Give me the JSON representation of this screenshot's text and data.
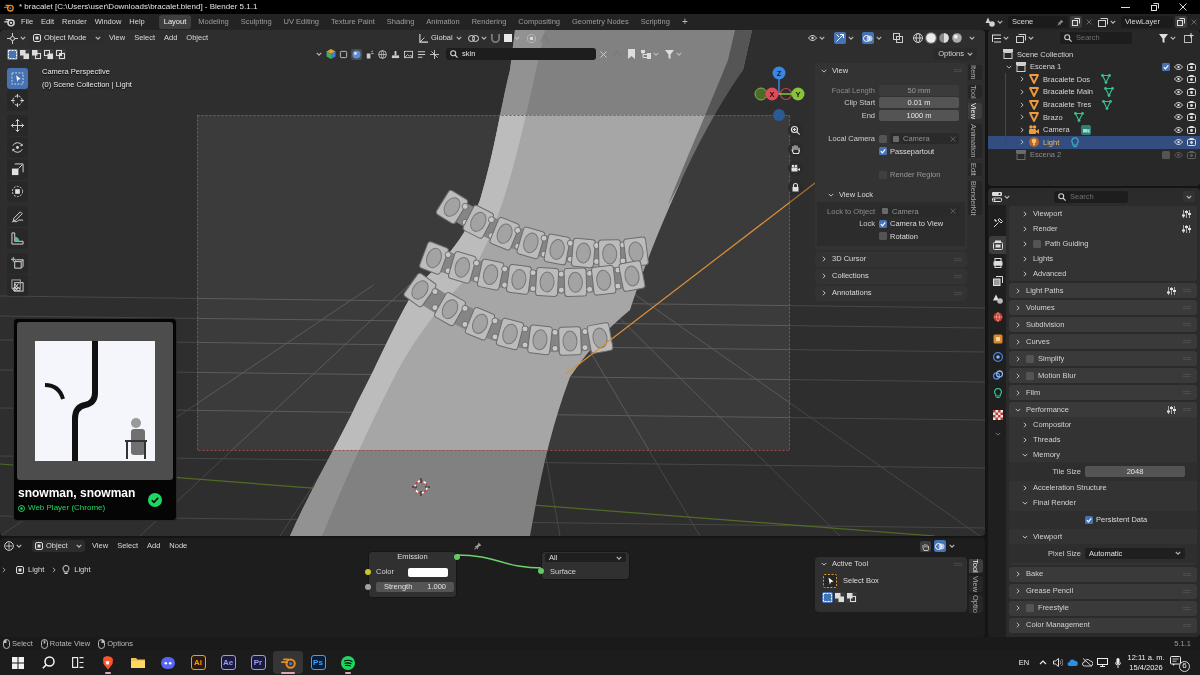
{
  "title_bar": {
    "title": "* bracalet [C:\\Users\\user\\Downloads\\bracalet.blend] - Blender 5.1.1"
  },
  "top_bar": {
    "menus": [
      "File",
      "Edit",
      "Render",
      "Window",
      "Help"
    ],
    "workspaces": [
      {
        "label": "Layout",
        "selected": true
      },
      {
        "label": "Modeling",
        "selected": false
      },
      {
        "label": "Sculpting",
        "selected": false
      },
      {
        "label": "UV Editing",
        "selected": false
      },
      {
        "label": "Texture Paint",
        "selected": false
      },
      {
        "label": "Shading",
        "selected": false
      },
      {
        "label": "Animation",
        "selected": false
      },
      {
        "label": "Rendering",
        "selected": false
      },
      {
        "label": "Compositing",
        "selected": false
      },
      {
        "label": "Geometry Nodes",
        "selected": false
      },
      {
        "label": "Scripting",
        "selected": false
      }
    ],
    "add_workspace": "+",
    "scene": "Scene",
    "view_layer": "ViewLayer"
  },
  "viewport": {
    "header": {
      "mode": "Object Mode",
      "menus": [
        "View",
        "Select",
        "Add",
        "Object"
      ],
      "orientation": "Global",
      "shading_modes": [
        {
          "kind": "wireframe",
          "selected": false
        },
        {
          "kind": "solid",
          "selected": true
        },
        {
          "kind": "material",
          "selected": false
        },
        {
          "kind": "rendered",
          "selected": false
        }
      ],
      "select_modes": [
        {
          "kind": "set",
          "selected": true
        },
        {
          "kind": "extend",
          "selected": false
        },
        {
          "kind": "subtract",
          "selected": false
        },
        {
          "kind": "invert",
          "selected": false
        },
        {
          "kind": "intersect",
          "selected": false
        }
      ],
      "search": "skin",
      "options": "Options"
    },
    "info": [
      "Camera Perspective",
      "(0) Scene Collection | Light"
    ],
    "tool_groups": [
      [
        {
          "kind": "select",
          "selected": true
        },
        {
          "kind": "cursor",
          "selected": false
        }
      ],
      [
        {
          "kind": "move",
          "selected": false
        },
        {
          "kind": "rotate",
          "selected": false
        },
        {
          "kind": "scale",
          "selected": false
        },
        {
          "kind": "transform",
          "selected": false
        }
      ],
      [
        {
          "kind": "annotate",
          "selected": false
        },
        {
          "kind": "measure",
          "selected": false
        }
      ],
      [
        {
          "kind": "add-cube",
          "selected": false
        },
        {
          "kind": "cut",
          "selected": false
        }
      ]
    ],
    "gizmo": {
      "x": "X",
      "y": "Y",
      "z": "Z"
    },
    "sidebar": {
      "tabs": [
        {
          "label": "Item",
          "selected": false
        },
        {
          "label": "Tool",
          "selected": false
        },
        {
          "label": "View",
          "selected": true
        },
        {
          "label": "Animation",
          "selected": false
        },
        {
          "label": "Edit",
          "selected": false
        },
        {
          "label": "BlenderKit",
          "selected": false
        }
      ],
      "panels": [
        {
          "title": "View",
          "expanded": true,
          "groups": [
            [
              {
                "kind": "number",
                "label": "Focal Length",
                "value": "50 mm",
                "disabled": true
              },
              {
                "kind": "number",
                "label": "Clip Start",
                "value": "0.01 m",
                "disabled": false
              },
              {
                "kind": "number",
                "label": "End",
                "value": "1000 m",
                "disabled": false
              }
            ],
            [
              {
                "kind": "object",
                "label": "Local Camera",
                "checked": false,
                "value": "Camera",
                "disabled": true
              },
              {
                "kind": "check",
                "text": "Passepartout",
                "checked": true,
                "disabled": false
              }
            ],
            [
              {
                "kind": "check",
                "text": "Render Region",
                "checked": false,
                "disabled": true
              }
            ]
          ],
          "subpanels": [
            {
              "title": "View Lock",
              "expanded": true,
              "rows": [
                {
                  "kind": "object",
                  "label": "Lock to Object",
                  "value": "Camera",
                  "disabled": true
                },
                {
                  "kind": "check",
                  "label": "Lock",
                  "text": "Camera to View",
                  "checked": true,
                  "disabled": false
                },
                {
                  "kind": "check",
                  "text": "Rotation",
                  "checked": false,
                  "disabled": false
                }
              ]
            }
          ]
        },
        {
          "title": "3D Cursor",
          "expanded": false
        },
        {
          "title": "Collections",
          "expanded": false
        },
        {
          "title": "Annotations",
          "expanded": false
        }
      ]
    },
    "media_player": {
      "title": "snowman, snowman",
      "device": "Web Player (Chrome)"
    }
  },
  "outliner": {
    "search_placeholder": "Search",
    "tree": [
      {
        "kind": "scene-collection",
        "label": "Scene Collection",
        "selected": false,
        "children": [
          {
            "kind": "collection",
            "label": "Escena 1",
            "expanded": true,
            "included": true,
            "selected": false,
            "children": [
              {
                "kind": "mesh",
                "label": "Bracalete Dos",
                "expanded": false,
                "selected": false
              },
              {
                "kind": "mesh",
                "label": "Bracalete Main",
                "expanded": false,
                "selected": false
              },
              {
                "kind": "mesh",
                "label": "Bracalete Tres",
                "expanded": false,
                "selected": false
              },
              {
                "kind": "mesh",
                "label": "Brazo",
                "expanded": false,
                "selected": false
              },
              {
                "kind": "camera",
                "label": "Camera",
                "expanded": false,
                "selected": false
              },
              {
                "kind": "light",
                "label": "Light",
                "expanded": false,
                "selected": true
              }
            ]
          },
          {
            "kind": "collection",
            "label": "Escena 2",
            "included": false,
            "selected": false
          }
        ]
      }
    ]
  },
  "properties": {
    "search_placeholder": "Search",
    "tab_groups": [
      [
        {
          "kind": "tool",
          "selected": false
        }
      ],
      [
        {
          "kind": "render",
          "selected": true
        },
        {
          "kind": "output",
          "selected": false
        },
        {
          "kind": "view-layer",
          "selected": false
        },
        {
          "kind": "scene",
          "selected": false
        },
        {
          "kind": "world",
          "selected": false
        }
      ],
      [
        {
          "kind": "object",
          "selected": false
        },
        {
          "kind": "physics",
          "selected": false
        },
        {
          "kind": "constraints",
          "selected": false
        },
        {
          "kind": "light-data",
          "selected": false
        }
      ],
      [
        {
          "kind": "texture",
          "selected": false
        }
      ]
    ],
    "top_subpanels": [
      {
        "title": "Viewport",
        "expanded": false,
        "presets": true
      },
      {
        "title": "Render",
        "expanded": false,
        "presets": true
      },
      {
        "title": "Path Guiding",
        "expanded": false,
        "checked": false
      },
      {
        "title": "Lights",
        "expanded": false
      },
      {
        "title": "Advanced",
        "expanded": false
      }
    ],
    "panels": [
      {
        "title": "Light Paths",
        "expanded": false,
        "presets": true
      },
      {
        "title": "Volumes",
        "expanded": false
      },
      {
        "title": "Subdivision",
        "expanded": false
      },
      {
        "title": "Curves",
        "expanded": false
      },
      {
        "title": "Simplify",
        "expanded": false,
        "checked": false
      },
      {
        "title": "Motion Blur",
        "expanded": false,
        "checked": false
      },
      {
        "title": "Film",
        "expanded": false
      },
      {
        "title": "Performance",
        "expanded": true,
        "presets": true,
        "children": [
          {
            "kind": "subpanel",
            "title": "Compositor",
            "expanded": false
          },
          {
            "kind": "subpanel",
            "title": "Threads",
            "expanded": false
          },
          {
            "kind": "subpanel",
            "title": "Memory",
            "expanded": true,
            "children": [
              {
                "kind": "number",
                "label": "Tile Size",
                "value": "2048"
              }
            ]
          },
          {
            "kind": "subpanel",
            "title": "Acceleration Structure",
            "expanded": false
          },
          {
            "kind": "subpanel",
            "title": "Final Render",
            "expanded": true,
            "children": [
              {
                "kind": "check",
                "text": "Persistent Data",
                "checked": true
              }
            ]
          },
          {
            "kind": "subpanel",
            "title": "Viewport",
            "expanded": true,
            "children": [
              {
                "kind": "dropdown",
                "label": "Pixel Size",
                "value": "Automatic"
              }
            ]
          }
        ]
      },
      {
        "title": "Bake",
        "expanded": false
      },
      {
        "title": "Grease Pencil",
        "expanded": false
      },
      {
        "title": "Freestyle",
        "expanded": false,
        "checked": false
      },
      {
        "title": "Color Management",
        "expanded": false
      }
    ]
  },
  "node_editor": {
    "header": {
      "data_type": "Object",
      "menus": [
        "View",
        "Select",
        "Add",
        "Node"
      ]
    },
    "breadcrumbs": [
      "Light",
      "Light"
    ],
    "emission_node": {
      "title": "Emission",
      "color_label": "Color",
      "color": "#ffffff",
      "strength_label": "Strength",
      "strength": "1.000"
    },
    "output_node": {
      "target": "All",
      "input": "Surface"
    },
    "active_tool": {
      "title": "Active Tool",
      "expanded": true,
      "tool": "Select Box",
      "select_modes": [
        {
          "kind": "set",
          "selected": true
        },
        {
          "kind": "extend",
          "selected": false
        },
        {
          "kind": "subtract",
          "selected": false
        }
      ]
    },
    "tabs": [
      {
        "label": "Tool",
        "selected": true
      },
      {
        "label": "View",
        "selected": false
      },
      {
        "label": "Optio",
        "selected": false
      }
    ]
  },
  "status_bar": {
    "hints": [
      {
        "kind": "left-click",
        "text": "Select"
      },
      {
        "kind": "middle-click",
        "text": "Rotate View"
      },
      {
        "kind": "right-click",
        "text": "Options"
      }
    ],
    "version": "5.1.1"
  },
  "taskbar": {
    "apps": [
      {
        "kind": "browser",
        "running": true,
        "active": false
      },
      {
        "kind": "folder",
        "running": false,
        "active": false
      },
      {
        "kind": "chat",
        "running": false,
        "active": false
      },
      {
        "kind": "tile",
        "label": "Ai",
        "color": "#ff9a00",
        "running": false,
        "active": false
      },
      {
        "kind": "tile",
        "label": "Ae",
        "color": "#9999ff",
        "running": false,
        "active": false
      },
      {
        "kind": "tile",
        "label": "Pr",
        "color": "#9999ff",
        "running": false,
        "active": false
      },
      {
        "kind": "blender",
        "running": true,
        "active": true
      },
      {
        "kind": "tile",
        "label": "Ps",
        "color": "#31a8ff",
        "running": false,
        "active": false
      },
      {
        "kind": "music",
        "running": true,
        "active": false
      }
    ],
    "language": "EN",
    "time": "12:11 a. m.",
    "date": "15/4/2026",
    "notification_count": "6"
  }
}
